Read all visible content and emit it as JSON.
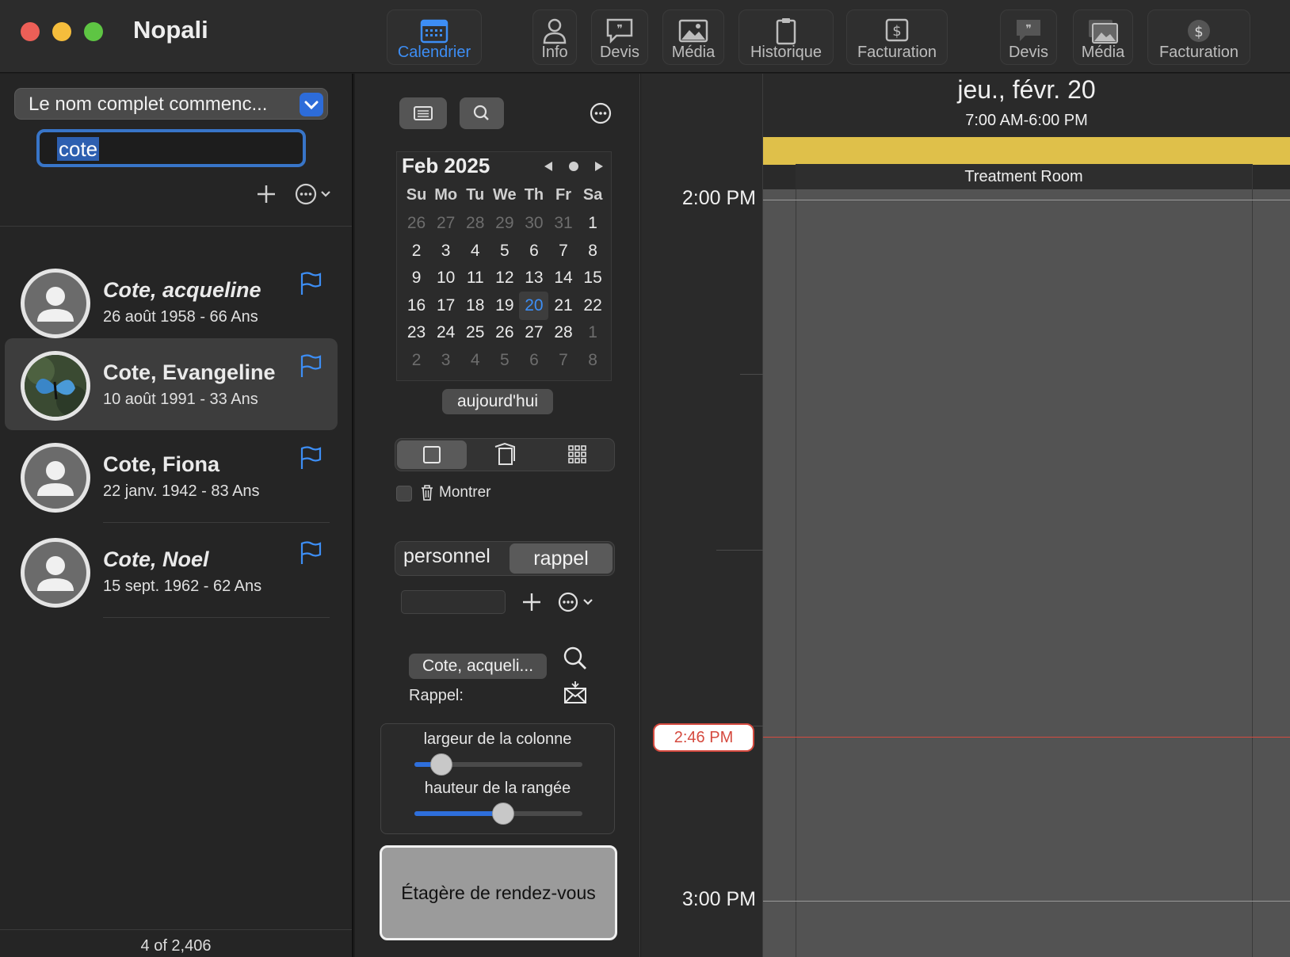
{
  "app": {
    "title": "Nopali"
  },
  "toolbar": {
    "calendrier": "Calendrier",
    "info": "Info",
    "devis": "Devis",
    "media": "Média",
    "historique": "Historique",
    "facturation": "Facturation",
    "devis2": "Devis",
    "media2": "Média",
    "facturation2": "Facturation",
    "accent": "#3d8ef5"
  },
  "search": {
    "filter": "Le nom complet commenc...",
    "query": "cote"
  },
  "patients": [
    {
      "name": "Cote, acqueline",
      "dob": "26 août 1958 - 66 Ans"
    },
    {
      "name": "Cote, Evangeline",
      "dob": "10 août 1991 - 33 Ans"
    },
    {
      "name": "Cote, Fiona",
      "dob": "22 janv. 1942 - 83 Ans"
    },
    {
      "name": "Cote, Noel",
      "dob": "15 sept. 1962 - 62 Ans"
    }
  ],
  "count": "4 of 2,406",
  "mini_calendar": {
    "month": "Feb 2025",
    "weekdays": [
      "Su",
      "Mo",
      "Tu",
      "We",
      "Th",
      "Fr",
      "Sa"
    ],
    "weeks": [
      [
        "26",
        "27",
        "28",
        "29",
        "30",
        "31",
        "1"
      ],
      [
        "2",
        "3",
        "4",
        "5",
        "6",
        "7",
        "8"
      ],
      [
        "9",
        "10",
        "11",
        "12",
        "13",
        "14",
        "15"
      ],
      [
        "16",
        "17",
        "18",
        "19",
        "20",
        "21",
        "22"
      ],
      [
        "23",
        "24",
        "25",
        "26",
        "27",
        "28",
        "1"
      ],
      [
        "2",
        "3",
        "4",
        "5",
        "6",
        "7",
        "8"
      ]
    ],
    "today": "20",
    "today_button": "aujourd'hui"
  },
  "options": {
    "show_label": "Montrer",
    "show_checked": false,
    "mode_personnel": "personnel",
    "mode_rappel": "rappel",
    "patient_chip": "Cote, acqueli...",
    "rappel_label": "Rappel:",
    "column_width_label": "largeur de la colonne",
    "column_width_value": 0.16,
    "row_height_label": "hauteur de la rangée",
    "row_height_value": 0.53,
    "shelf": "Étagère de rendez-vous"
  },
  "day_view": {
    "date": "jeu., févr. 20",
    "hours": "7:00 AM-6:00 PM",
    "room": "Treatment Room",
    "hour_labels": [
      "2:00 PM",
      "3:00 PM"
    ],
    "now": "2:46 PM",
    "allday_color": "#dfc04a",
    "now_color": "#d54a3f"
  }
}
